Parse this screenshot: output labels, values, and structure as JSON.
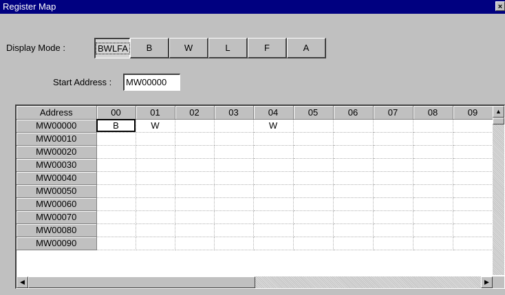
{
  "window": {
    "title": "Register Map",
    "close_label": "×"
  },
  "display_mode": {
    "label": "Display Mode :",
    "options": [
      "BWLFA",
      "B",
      "W",
      "L",
      "F",
      "A"
    ],
    "selected": "BWLFA"
  },
  "start_address": {
    "label": "Start Address :",
    "value": "MW00000"
  },
  "grid": {
    "corner_header": "Address",
    "columns": [
      "00",
      "01",
      "02",
      "03",
      "04",
      "05",
      "06",
      "07",
      "08",
      "09"
    ],
    "rows": [
      {
        "address": "MW00000",
        "cells": [
          "B",
          "W",
          "",
          "",
          "W",
          "",
          "",
          "",
          "",
          ""
        ]
      },
      {
        "address": "MW00010",
        "cells": [
          "",
          "",
          "",
          "",
          "",
          "",
          "",
          "",
          "",
          ""
        ]
      },
      {
        "address": "MW00020",
        "cells": [
          "",
          "",
          "",
          "",
          "",
          "",
          "",
          "",
          "",
          ""
        ]
      },
      {
        "address": "MW00030",
        "cells": [
          "",
          "",
          "",
          "",
          "",
          "",
          "",
          "",
          "",
          ""
        ]
      },
      {
        "address": "MW00040",
        "cells": [
          "",
          "",
          "",
          "",
          "",
          "",
          "",
          "",
          "",
          ""
        ]
      },
      {
        "address": "MW00050",
        "cells": [
          "",
          "",
          "",
          "",
          "",
          "",
          "",
          "",
          "",
          ""
        ]
      },
      {
        "address": "MW00060",
        "cells": [
          "",
          "",
          "",
          "",
          "",
          "",
          "",
          "",
          "",
          ""
        ]
      },
      {
        "address": "MW00070",
        "cells": [
          "",
          "",
          "",
          "",
          "",
          "",
          "",
          "",
          "",
          ""
        ]
      },
      {
        "address": "MW00080",
        "cells": [
          "",
          "",
          "",
          "",
          "",
          "",
          "",
          "",
          "",
          ""
        ]
      },
      {
        "address": "MW00090",
        "cells": [
          "",
          "",
          "",
          "",
          "",
          "",
          "",
          "",
          "",
          ""
        ]
      }
    ],
    "selected_cell": {
      "row": 0,
      "col": 0
    }
  },
  "scroll_icons": {
    "up": "▲",
    "left": "◀",
    "right": "▶"
  }
}
